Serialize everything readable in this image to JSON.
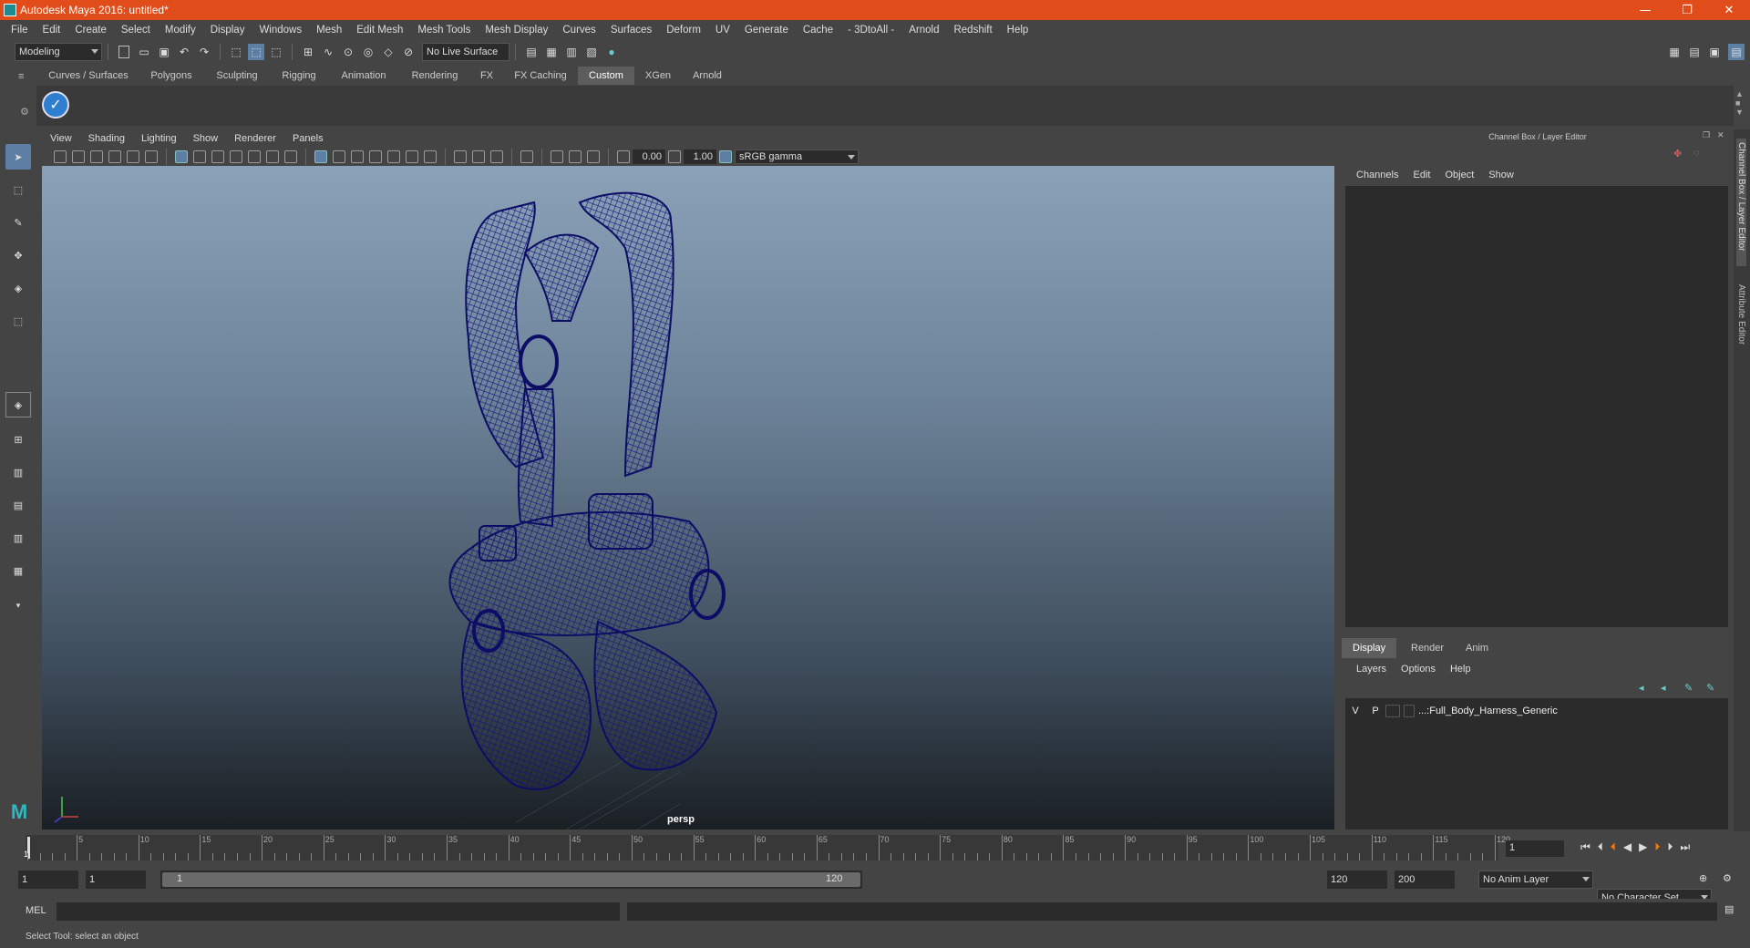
{
  "window": {
    "title": "Autodesk Maya 2016: untitled*",
    "minimize": "—",
    "restore": "❐",
    "close": "✕"
  },
  "menubar": [
    "File",
    "Edit",
    "Create",
    "Select",
    "Modify",
    "Display",
    "Windows",
    "Mesh",
    "Edit Mesh",
    "Mesh Tools",
    "Mesh Display",
    "Curves",
    "Surfaces",
    "Deform",
    "UV",
    "Generate",
    "Cache",
    "- 3DtoAll -",
    "Arnold",
    "Redshift",
    "Help"
  ],
  "statusline": {
    "mode": "Modeling",
    "live_surface": "No Live Surface"
  },
  "shelf": {
    "tabs": [
      "Curves / Surfaces",
      "Polygons",
      "Sculpting",
      "Rigging",
      "Animation",
      "Rendering",
      "FX",
      "FX Caching",
      "Custom",
      "XGen",
      "Arnold"
    ],
    "active": "Custom"
  },
  "viewport": {
    "menu": [
      "View",
      "Shading",
      "Lighting",
      "Show",
      "Renderer",
      "Panels"
    ],
    "exposure": "0.00",
    "gamma": "1.00",
    "color_space": "sRGB gamma",
    "camera": "persp"
  },
  "channelbox": {
    "title": "Channel Box / Layer Editor",
    "menu": [
      "Channels",
      "Edit",
      "Object",
      "Show"
    ]
  },
  "layereditor": {
    "tabs": [
      "Display",
      "Render",
      "Anim"
    ],
    "active_tab": "Display",
    "menu": [
      "Layers",
      "Options",
      "Help"
    ],
    "layers": [
      {
        "v": "V",
        "p": "P",
        "name": "...:Full_Body_Harness_Generic"
      }
    ]
  },
  "sidetabs": {
    "channel_box": "Channel Box / Layer Editor",
    "attribute_editor": "Attribute Editor"
  },
  "timeline": {
    "ticks": [
      "5",
      "10",
      "15",
      "20",
      "25",
      "30",
      "35",
      "40",
      "45",
      "50",
      "55",
      "60",
      "65",
      "70",
      "75",
      "80",
      "85",
      "90",
      "95",
      "100",
      "105",
      "110",
      "115",
      "120"
    ],
    "start_label": "1",
    "current_frame": "1"
  },
  "range": {
    "start": "1",
    "playback_start": "1",
    "slider_start": "1",
    "slider_end": "120",
    "playback_end": "120",
    "end": "200",
    "anim_layer": "No Anim Layer",
    "character_set": "No Character Set"
  },
  "command": {
    "label": "MEL"
  },
  "help_line": "Select Tool: select an object",
  "colors": {
    "title_bar": "#e14d1a",
    "wireframe": "#1a1a7a",
    "selection": "#5c7fa3"
  }
}
